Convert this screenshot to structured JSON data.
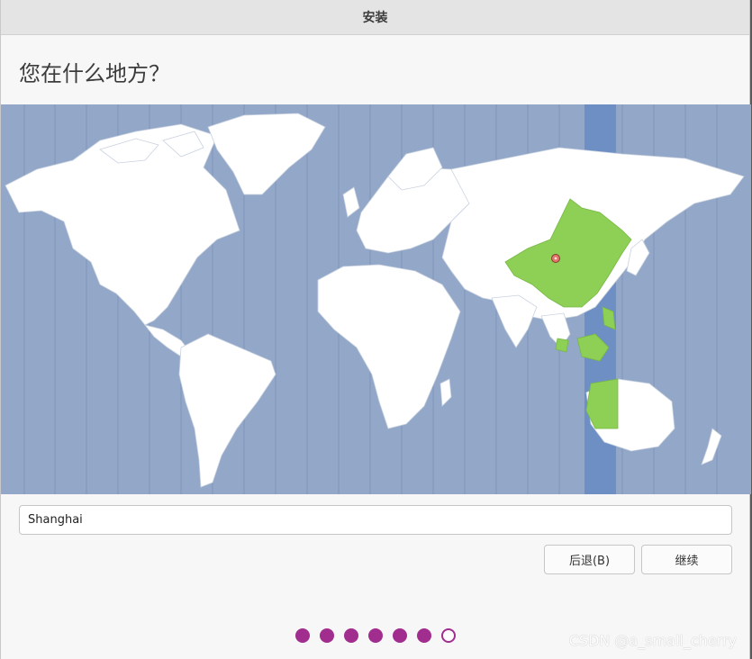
{
  "window": {
    "title": "安装"
  },
  "page": {
    "heading": "您在什么地方？"
  },
  "map": {
    "ocean_color": "#93a8c8",
    "land_color": "#ffffff",
    "highlight_color": "#8ecf55",
    "selected_zone_color": "#6e8fc4",
    "pin_color": "#e0776a"
  },
  "timezone": {
    "value": "Shanghai"
  },
  "buttons": {
    "back": "后退(B)",
    "next": "继续"
  },
  "steps": {
    "total": 7,
    "completed": 6,
    "accent": "#a12d8e"
  },
  "watermark": "CSDN @a_small_cherry"
}
